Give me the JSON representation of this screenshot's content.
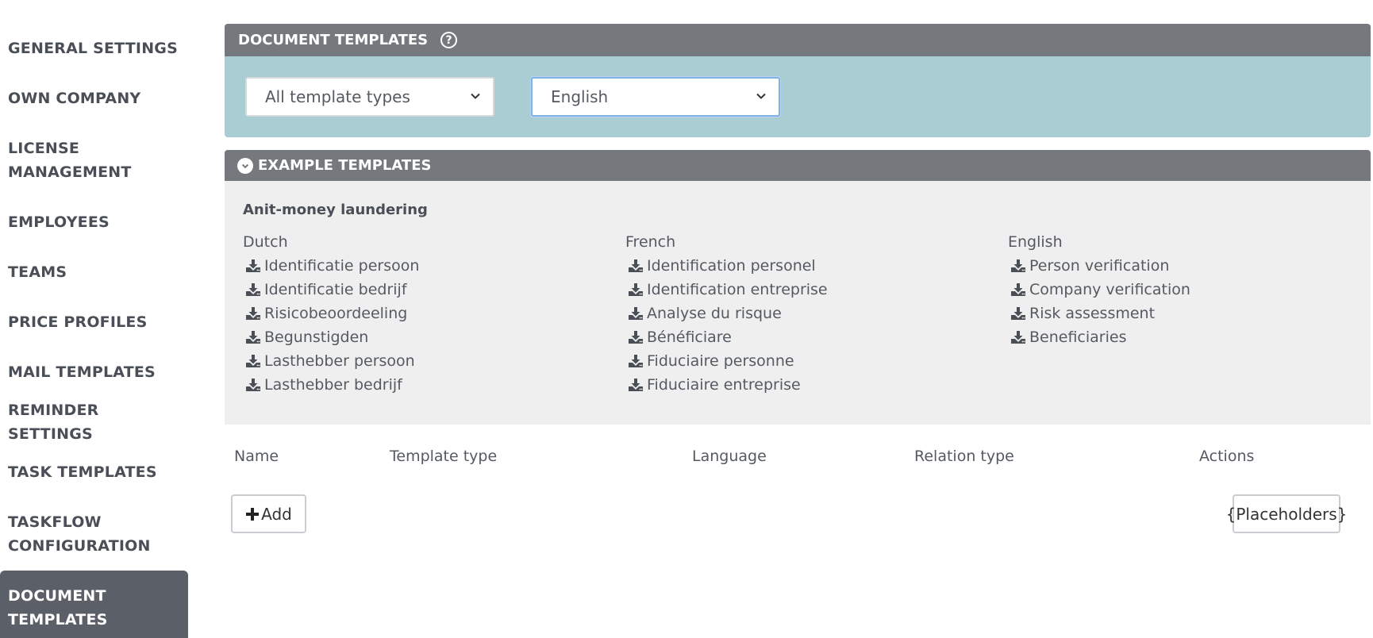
{
  "sidebar": {
    "items": [
      {
        "label": "GENERAL SETTINGS",
        "active": false
      },
      {
        "label": "OWN COMPANY",
        "active": false
      },
      {
        "label": "LICENSE\nMANAGEMENT",
        "active": false
      },
      {
        "label": "EMPLOYEES",
        "active": false
      },
      {
        "label": "TEAMS",
        "active": false
      },
      {
        "label": "PRICE PROFILES",
        "active": false
      },
      {
        "label": "MAIL TEMPLATES",
        "active": false
      },
      {
        "label": "REMINDER SETTINGS",
        "active": false
      },
      {
        "label": "TASK TEMPLATES",
        "active": false
      },
      {
        "label": "TASKFLOW\nCONFIGURATION",
        "active": false
      },
      {
        "label": "DOCUMENT\nTEMPLATES",
        "active": true
      }
    ]
  },
  "document_templates": {
    "title": "DOCUMENT TEMPLATES",
    "help_icon": "?",
    "template_type_select": {
      "value": "All template types"
    },
    "language_select": {
      "value": "English"
    }
  },
  "example_templates": {
    "title": "EXAMPLE TEMPLATES",
    "section_title": "Anit-money laundering",
    "columns": [
      {
        "language": "Dutch",
        "items": [
          "Identificatie persoon",
          "Identificatie bedrijf",
          "Risicobeoordeeling",
          "Begunstigden",
          "Lasthebber persoon",
          "Lasthebber bedrijf"
        ]
      },
      {
        "language": "French",
        "items": [
          "Identification personel",
          "Identification entreprise",
          "Analyse du risque",
          "Bénéficiare",
          "Fiduciaire personne",
          "Fiduciaire entreprise"
        ]
      },
      {
        "language": "English",
        "items": [
          "Person verification",
          "Company verification",
          "Risk assessment",
          "Beneficiaries"
        ]
      }
    ]
  },
  "table": {
    "headers": [
      "Name",
      "Template type",
      "Language",
      "Relation type",
      "Actions"
    ]
  },
  "buttons": {
    "add": "Add",
    "placeholders": "{Placeholders}"
  },
  "colors": {
    "header_gray": "#75797e",
    "filter_teal": "#a9cdd3",
    "active_sidebar": "#5b5f68"
  }
}
